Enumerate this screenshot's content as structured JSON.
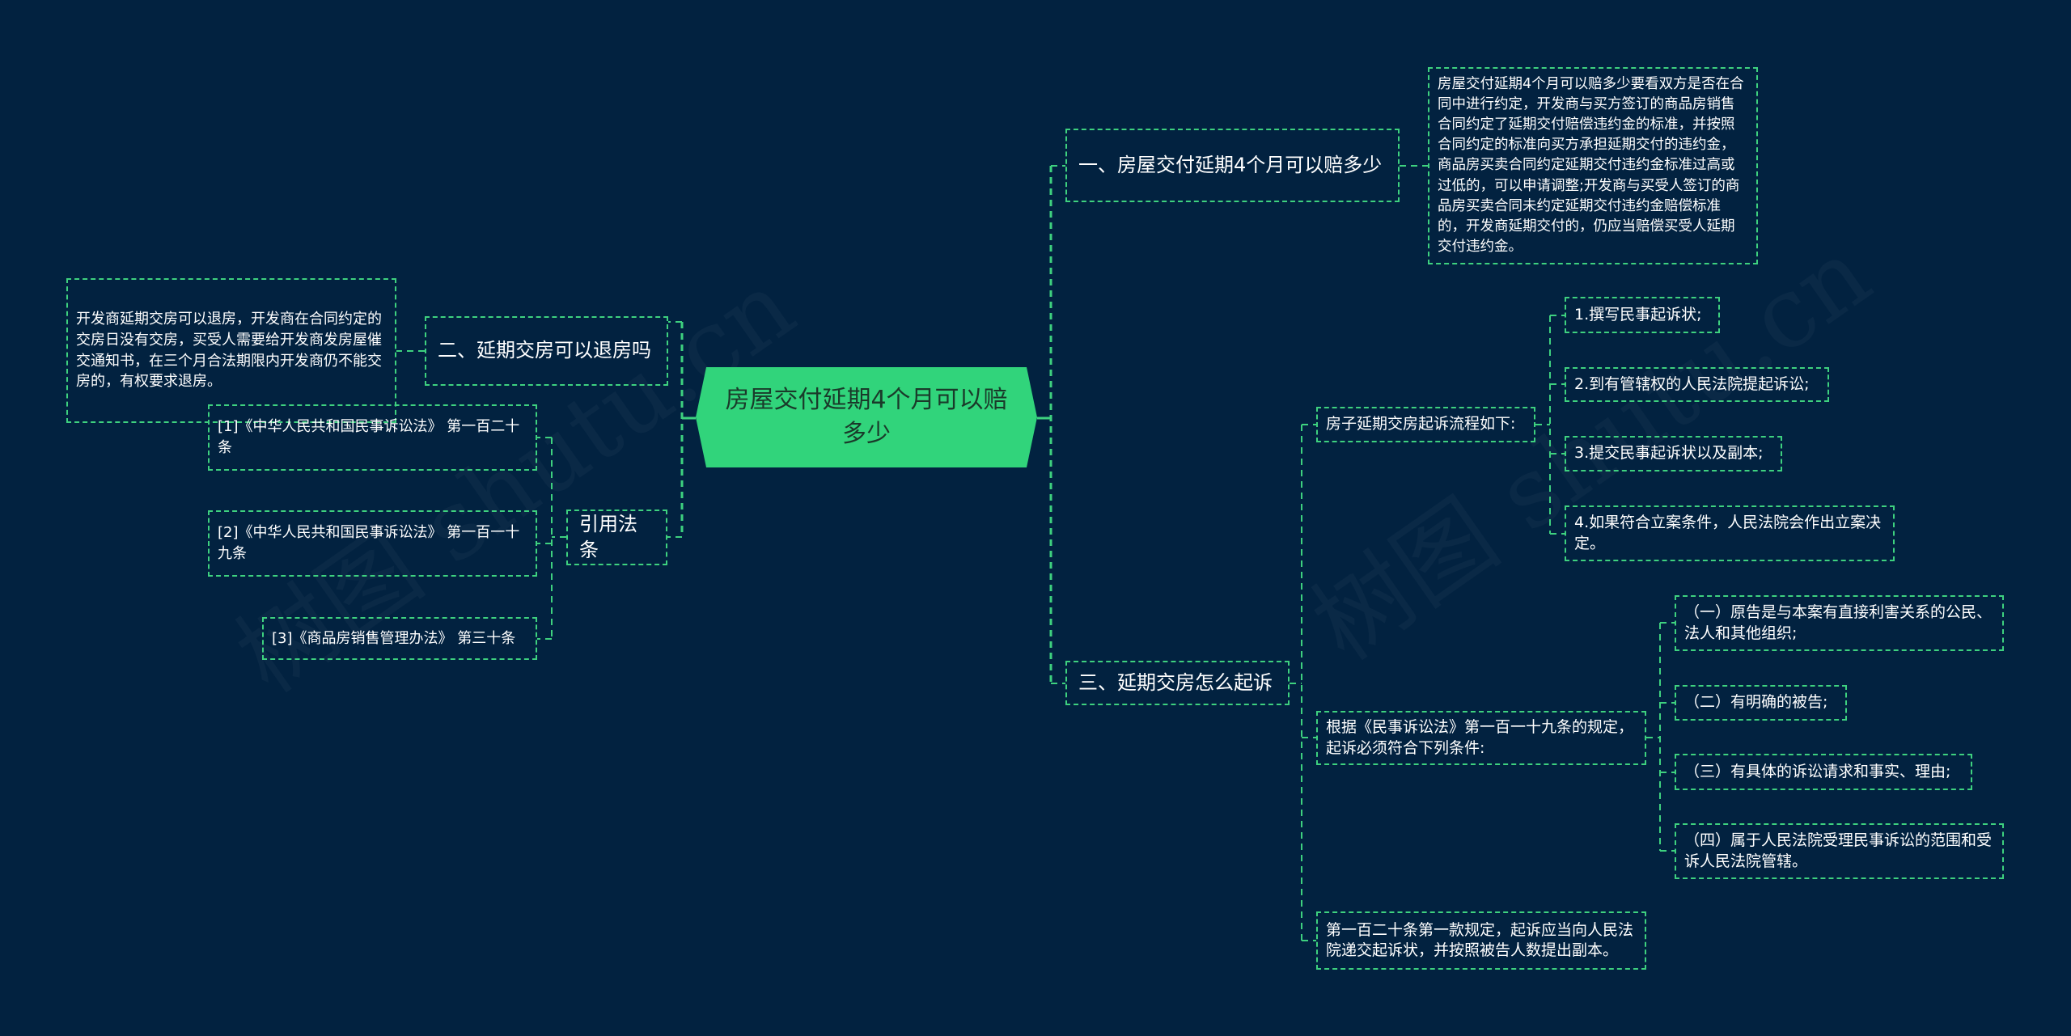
{
  "root": {
    "label": "房屋交付延期4个月可以赔多少"
  },
  "colors": {
    "background": "#022240",
    "accent": "#31d47b",
    "line": "#3ed17f",
    "text": "#ffffff"
  },
  "branches": {
    "b1": {
      "label": "一、房屋交付延期4个月可以赔多少",
      "children": [
        {
          "text": "房屋交付延期4个月可以赔多少要看双方是否在合同中进行约定，开发商与买方签订的商品房销售合同约定了延期交付赔偿违约金的标准，并按照合同约定的标准向买方承担延期交付的违约金，商品房买卖合同约定延期交付违约金标准过高或过低的，可以申请调整;开发商与买受人签订的商品房买卖合同未约定延期交付违约金赔偿标准的，开发商延期交付的，仍应当赔偿买受人延期交付违约金。"
        }
      ]
    },
    "b2": {
      "label": "二、延期交房可以退房吗",
      "children": [
        {
          "text": "开发商延期交房可以退房，开发商在合同约定的交房日没有交房，买受人需要给开发商发房屋催交通知书，在三个月合法期限内开发商仍不能交房的，有权要求退房。"
        }
      ]
    },
    "b3": {
      "label": "三、延期交房怎么起诉",
      "children": [
        {
          "text": "房子延期交房起诉流程如下:",
          "children": [
            {
              "text": "1.撰写民事起诉状;"
            },
            {
              "text": "2.到有管辖权的人民法院提起诉讼;"
            },
            {
              "text": "3.提交民事起诉状以及副本;"
            },
            {
              "text": "4.如果符合立案条件，人民法院会作出立案决定。"
            }
          ]
        },
        {
          "text": "根据《民事诉讼法》第一百一十九条的规定，起诉必须符合下列条件:",
          "children": [
            {
              "text": "（一）原告是与本案有直接利害关系的公民、法人和其他组织;"
            },
            {
              "text": "（二）有明确的被告;"
            },
            {
              "text": "（三）有具体的诉讼请求和事实、理由;"
            },
            {
              "text": "（四）属于人民法院受理民事诉讼的范围和受诉人民法院管辖。"
            }
          ]
        },
        {
          "text": "第一百二十条第一款规定，起诉应当向人民法院递交起诉状，并按照被告人数提出副本。"
        }
      ]
    },
    "b4": {
      "label": "引用法条",
      "children": [
        {
          "text": "[1]《中华人民共和国民事诉讼法》 第一百二十条"
        },
        {
          "text": "[2]《中华人民共和国民事诉讼法》 第一百一十九条"
        },
        {
          "text": "[3]《商品房销售管理办法》 第三十条"
        }
      ]
    }
  },
  "watermark": {
    "text": "树图 shutu.cn"
  }
}
